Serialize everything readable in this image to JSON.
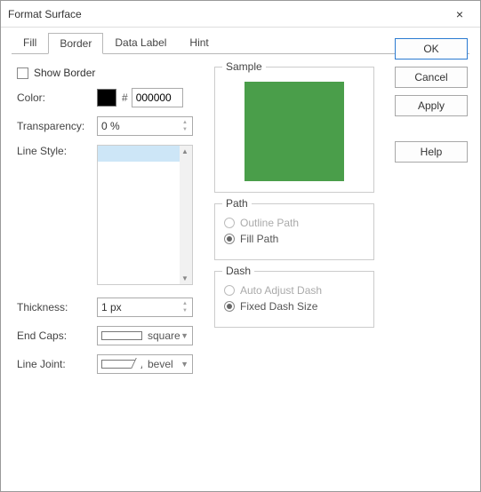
{
  "window": {
    "title": "Format Surface"
  },
  "tabs": {
    "fill": "Fill",
    "border": "Border",
    "data_label": "Data Label",
    "hint": "Hint",
    "active": "border"
  },
  "buttons": {
    "ok": "OK",
    "cancel": "Cancel",
    "apply": "Apply",
    "help": "Help"
  },
  "border": {
    "show_border_label": "Show Border",
    "color_label": "Color:",
    "color_hash": "#",
    "color_value": "000000",
    "color_swatch": "#000000",
    "transparency_label": "Transparency:",
    "transparency_value": "0 %",
    "line_style_label": "Line Style:",
    "thickness_label": "Thickness:",
    "thickness_value": "1 px",
    "end_caps_label": "End Caps:",
    "end_caps_value": "square",
    "line_joint_label": "Line Joint:",
    "line_joint_value": "bevel"
  },
  "sample": {
    "label": "Sample",
    "color": "#4a9e4a"
  },
  "path": {
    "label": "Path",
    "outline": "Outline Path",
    "fill": "Fill Path",
    "selected": "fill"
  },
  "dash": {
    "label": "Dash",
    "auto": "Auto Adjust Dash",
    "fixed": "Fixed Dash Size",
    "selected": "fixed"
  }
}
